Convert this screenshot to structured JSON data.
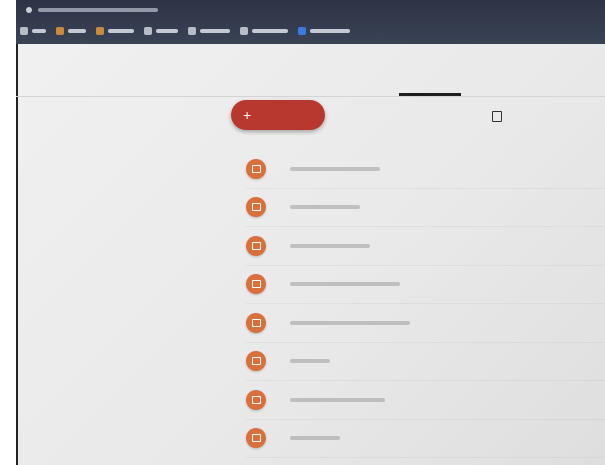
{
  "browser": {
    "url": "",
    "bookmarks": [
      {
        "icon": "bookmark-icon",
        "label": ""
      },
      {
        "icon": "bookmark-icon",
        "label": ""
      },
      {
        "icon": "bookmark-icon",
        "label": ""
      },
      {
        "icon": "bookmark-icon",
        "label": ""
      },
      {
        "icon": "bookmark-icon",
        "label": ""
      },
      {
        "icon": "bookmark-icon",
        "label": ""
      },
      {
        "icon": "bookmark-icon",
        "label": ""
      }
    ]
  },
  "header": {
    "title": "",
    "tabs": [
      {
        "label": "",
        "active": false
      },
      {
        "label": "",
        "active": true
      },
      {
        "label": "",
        "active": false
      },
      {
        "label": "",
        "active": false
      }
    ]
  },
  "actions": {
    "create_label": "",
    "share_label": ""
  },
  "sidebar": {
    "items": [
      {
        "label": ""
      },
      {
        "label": ""
      },
      {
        "label": ""
      },
      {
        "label": ""
      },
      {
        "label": ""
      },
      {
        "label": ""
      }
    ]
  },
  "list": {
    "items": [
      {
        "label": ""
      },
      {
        "label": ""
      },
      {
        "label": ""
      },
      {
        "label": ""
      },
      {
        "label": ""
      },
      {
        "label": ""
      },
      {
        "label": ""
      },
      {
        "label": ""
      }
    ]
  },
  "colors": {
    "accent": "#b8372e",
    "folder": "#d96f3a",
    "chrome": "#2d3446"
  }
}
